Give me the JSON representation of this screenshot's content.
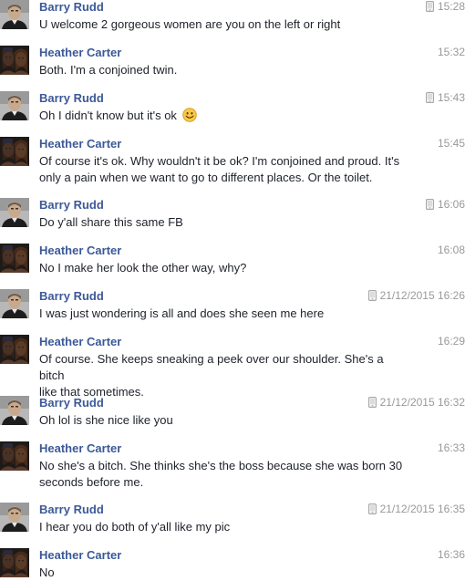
{
  "messages": [
    {
      "sender": "Barry Rudd",
      "avatar": "man-avatar",
      "time": "15:28",
      "mobile": true,
      "lines": [
        "U welcome 2 gorgeous women are you on the left or right"
      ]
    },
    {
      "sender": "Heather Carter",
      "avatar": "twins-avatar",
      "time": "15:32",
      "mobile": false,
      "lines": [
        "Both. I'm a conjoined twin."
      ]
    },
    {
      "sender": "Barry Rudd",
      "avatar": "man-avatar",
      "time": "15:43",
      "mobile": true,
      "lines": [
        "Oh I didn't know but it's ok"
      ],
      "emoji": "smiley-emoji"
    },
    {
      "sender": "Heather Carter",
      "avatar": "twins-avatar",
      "time": "15:45",
      "mobile": false,
      "lines": [
        "Of course it's ok. Why wouldn't it be ok? I'm conjoined and proud. It's",
        "only a pain when we want to go to different places. Or the toilet."
      ]
    },
    {
      "sender": "Barry Rudd",
      "avatar": "man-avatar",
      "time": "16:06",
      "mobile": true,
      "lines": [
        "Do y'all share this same FB"
      ]
    },
    {
      "sender": "Heather Carter",
      "avatar": "twins-avatar",
      "time": "16:08",
      "mobile": false,
      "lines": [
        "No I make her look the other way, why?"
      ]
    },
    {
      "sender": "Barry Rudd",
      "avatar": "man-avatar",
      "time": "21/12/2015 16:26",
      "mobile": true,
      "lines": [
        "I was just wondering is all and does she seen me here"
      ]
    },
    {
      "sender": "Heather Carter",
      "avatar": "twins-avatar",
      "time": "16:29",
      "mobile": false,
      "lines": [
        "Of course. She keeps sneaking a peek over our shoulder. She's a bitch",
        "like that sometimes."
      ]
    },
    {
      "sender": "Barry Rudd",
      "avatar": "man-avatar",
      "time": "21/12/2015 16:32",
      "mobile": true,
      "lines": [
        "Oh lol is she nice like you"
      ]
    },
    {
      "sender": "Heather Carter",
      "avatar": "twins-avatar",
      "time": "16:33",
      "mobile": false,
      "lines": [
        "No she's a bitch. She thinks she's the boss because she was born 30",
        "seconds before me."
      ]
    },
    {
      "sender": "Barry Rudd",
      "avatar": "man-avatar",
      "time": "21/12/2015 16:35",
      "mobile": true,
      "lines": [
        "I hear you do both of y'all like my pic"
      ]
    },
    {
      "sender": "Heather Carter",
      "avatar": "twins-avatar",
      "time": "16:36",
      "mobile": false,
      "lines": [
        "No"
      ]
    }
  ]
}
